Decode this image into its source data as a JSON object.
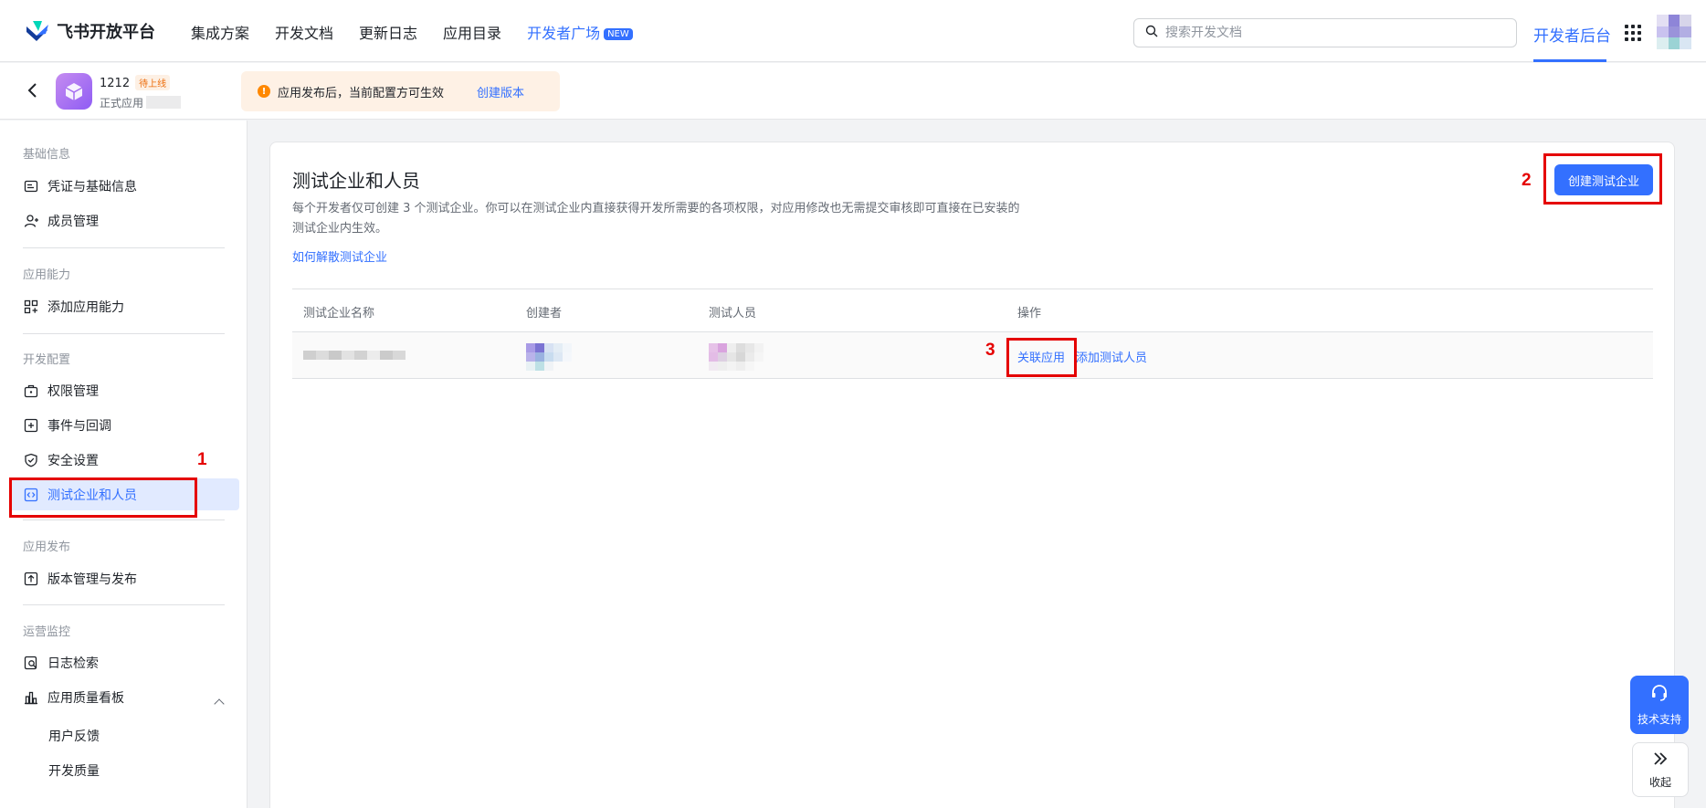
{
  "topnav": {
    "brand": "飞书开放平台",
    "links": [
      "集成方案",
      "开发文档",
      "更新日志",
      "应用目录",
      "开发者广场"
    ],
    "new_badge": "NEW",
    "search_placeholder": "搜索开发文档",
    "dev_console": "开发者后台"
  },
  "appbar": {
    "app_name": "1212",
    "app_status": "待上线",
    "app_type": "正式应用",
    "notice": "应用发布后，当前配置方可生效",
    "notice_link": "创建版本"
  },
  "sidebar": {
    "groups": [
      "基础信息",
      "应用能力",
      "开发配置",
      "应用发布",
      "运营监控"
    ],
    "items": [
      "凭证与基础信息",
      "成员管理",
      "添加应用能力",
      "权限管理",
      "事件与回调",
      "安全设置",
      "测试企业和人员",
      "版本管理与发布",
      "日志检索",
      "应用质量看板"
    ],
    "sub_items": [
      "用户反馈",
      "开发质量"
    ]
  },
  "main": {
    "title": "测试企业和人员",
    "desc": "每个开发者仅可创建 3 个测试企业。你可以在测试企业内直接获得开发所需要的各项权限，对应用修改也无需提交审核即可直接在已安装的测试企业内生效。",
    "link": "如何解散测试企业",
    "create_button": "创建测试企业",
    "columns": [
      "测试企业名称",
      "创建者",
      "测试人员",
      "操作"
    ],
    "row_actions": [
      "关联应用",
      "添加测试人员"
    ]
  },
  "annotations": [
    "1",
    "2",
    "3"
  ],
  "floating": {
    "support": "技术支持",
    "collapse": "收起"
  },
  "colors": {
    "accent": "#3370ff",
    "annotation": "#e50000",
    "warning": "#ff8800"
  }
}
